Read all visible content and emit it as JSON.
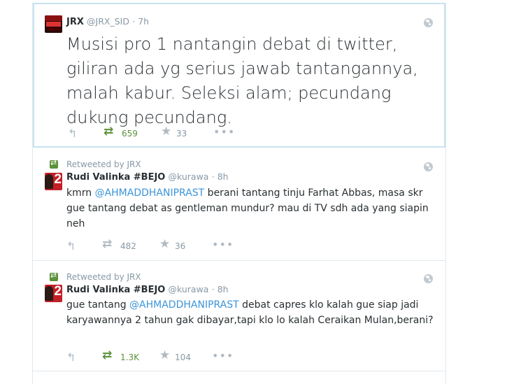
{
  "tweets": [
    {
      "fullname": "JRX",
      "username": "@JRX_SID",
      "dot": "·",
      "time": "7h",
      "text": "Musisi pro 1 nantangin debat di twitter, giliran ada yg serius jawab tantangannya, malah kabur. Seleksi alam; pecundang dukung pecundang.",
      "retweets": "659",
      "favorites": "33",
      "retweeted": true
    },
    {
      "context": "Retweeted by JRX",
      "fullname": "Rudi Valinka #BEJO",
      "username": "@kurawa",
      "dot": "·",
      "time": "8h",
      "text_before": "kmrn ",
      "mention": "@AHMADDHANIPRAST",
      "text_after": " berani tantang tinju Farhat Abbas, masa skr gue tantang debat as gentleman mundur? mau di TV sdh ada yang siapin neh",
      "retweets": "482",
      "favorites": "36",
      "retweeted": false
    },
    {
      "context": "Retweeted by JRX",
      "fullname": "Rudi Valinka #BEJO",
      "username": "@kurawa",
      "dot": "·",
      "time": "8h",
      "text_before": "gue tantang ",
      "mention": "@AHMADDHANIPRAST",
      "text_after": " debat capres klo kalah gue siap jadi karyawannya 2 tahun gak dibayar,tapi klo lo kalah Ceraikan Mulan,berani?",
      "retweets": "1.3K",
      "favorites": "104",
      "retweeted": true
    }
  ],
  "icons": {
    "reply": "reply-icon",
    "retweet": "retweet-icon",
    "favorite": "star-icon",
    "more": "more-icon",
    "globe": "globe-icon"
  },
  "colors": {
    "link": "#3b94d9",
    "retweet_active": "#5c913b",
    "muted": "#8899a6",
    "focus_border": "#c8e2f1"
  }
}
